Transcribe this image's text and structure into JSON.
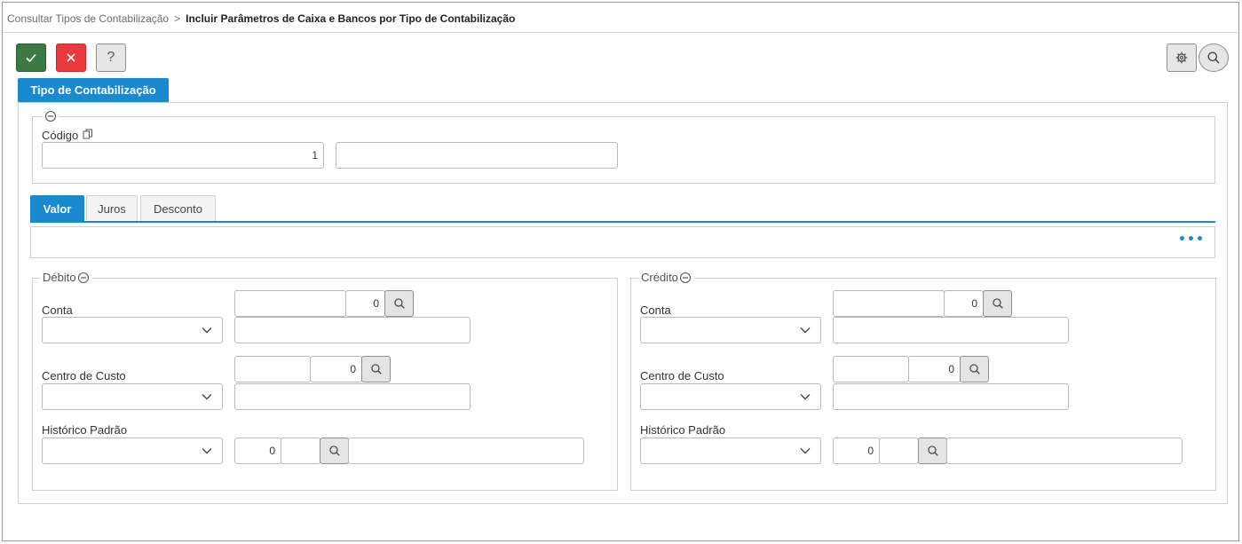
{
  "breadcrumb": {
    "parent": "Consultar Tipos de Contabilização",
    "separator": ">",
    "current": "Incluir Parâmetros de Caixa e Bancos por Tipo de Contabilização"
  },
  "toolbar": {
    "confirm_icon": "check-icon",
    "cancel_icon": "close-icon",
    "help_label": "?",
    "settings_icon": "gear-icon",
    "search_icon": "search-icon"
  },
  "main_tab": {
    "label": "Tipo de Contabilização"
  },
  "header_section": {
    "codigo_label": "Código",
    "codigo_value": "1",
    "descricao_value": ""
  },
  "tabs": [
    {
      "label": "Valor",
      "active": true
    },
    {
      "label": "Juros",
      "active": false
    },
    {
      "label": "Desconto",
      "active": false
    }
  ],
  "debito": {
    "legend": "Débito",
    "conta_label": "Conta",
    "conta_code": "",
    "conta_number": "0",
    "conta_description": "",
    "centro_label": "Centro de Custo",
    "centro_code": "",
    "centro_number": "0",
    "centro_description": "",
    "historico_label": "Histórico Padrão",
    "historico_number": "0",
    "historico_code": "",
    "historico_description": ""
  },
  "credito": {
    "legend": "Crédito",
    "conta_label": "Conta",
    "conta_code": "",
    "conta_number": "0",
    "conta_description": "",
    "centro_label": "Centro de Custo",
    "centro_code": "",
    "centro_number": "0",
    "centro_description": "",
    "historico_label": "Histórico Padrão",
    "historico_number": "0",
    "historico_code": "",
    "historico_description": ""
  },
  "colors": {
    "accent": "#1a8ad0",
    "confirm": "#3c7a45",
    "cancel": "#e8393c"
  }
}
